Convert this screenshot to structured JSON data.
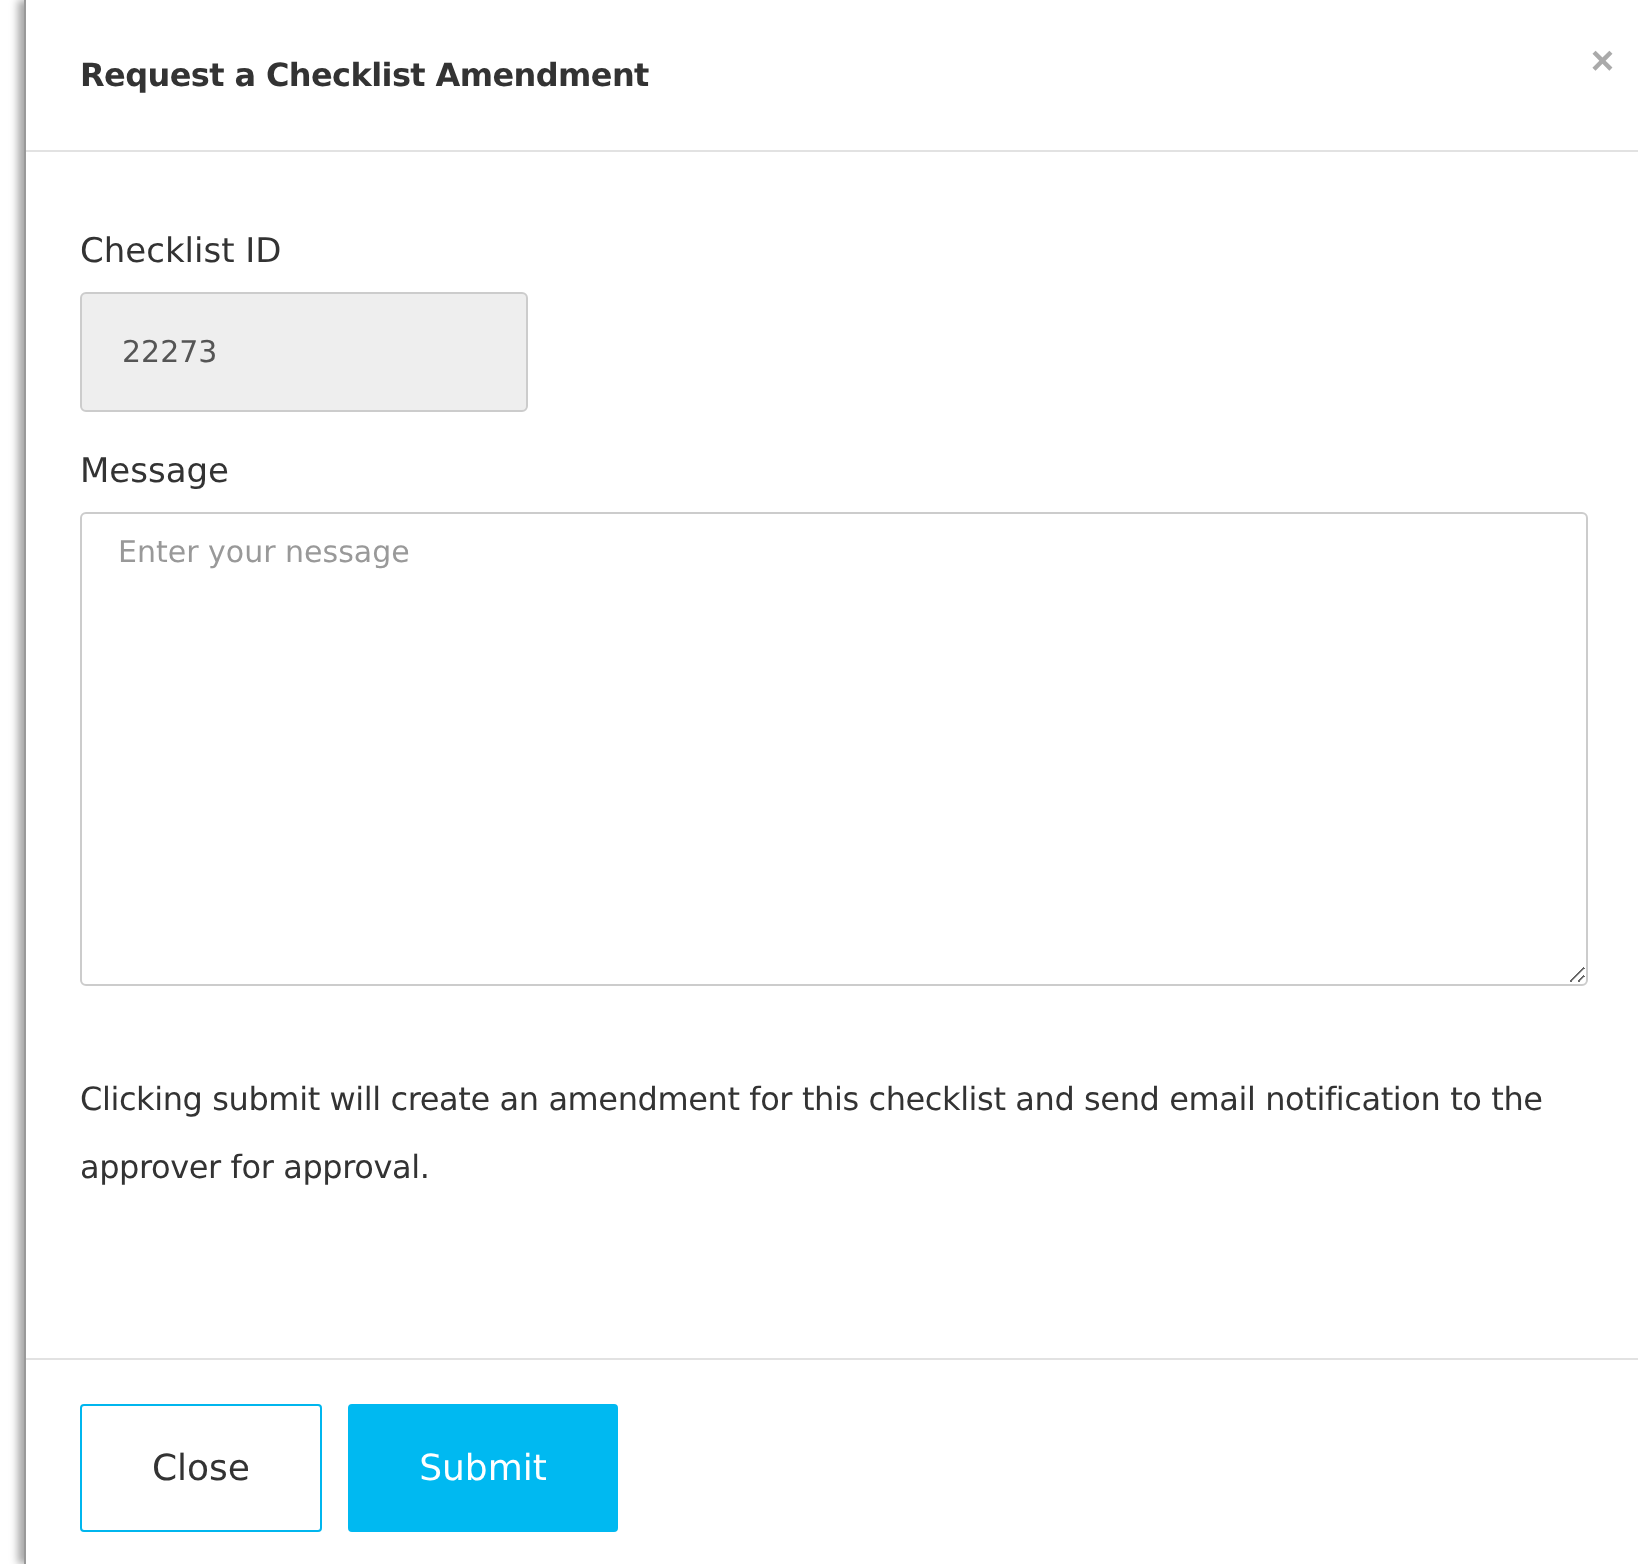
{
  "dialog": {
    "title": "Request a Checklist Amendment",
    "close_glyph": "×"
  },
  "fields": [
    {
      "label": "Checklist ID",
      "kind": "readonly",
      "value": "22273"
    },
    {
      "label": "Message",
      "kind": "textarea",
      "placeholder": "Enter your nessage"
    }
  ],
  "notice": "Clicking submit will create an amendment for this checklist and send email notification to the approver for approval.",
  "buttons": [
    {
      "label": "Close",
      "kind": "secondary"
    },
    {
      "label": "Submit",
      "kind": "primary"
    }
  ]
}
